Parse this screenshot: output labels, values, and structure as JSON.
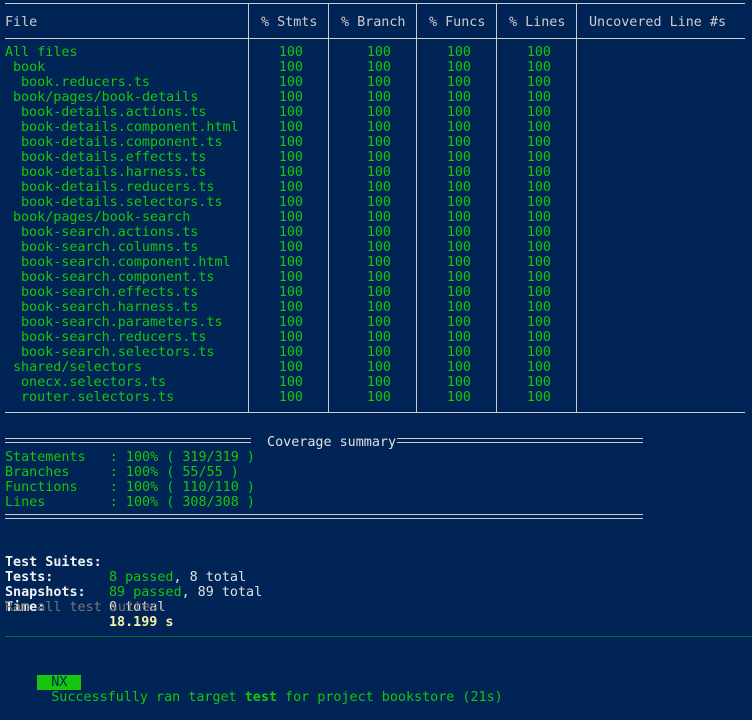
{
  "header": {
    "file": "File",
    "stmts": "% Stmts",
    "branch": "% Branch",
    "funcs": "% Funcs",
    "lines": "% Lines",
    "uncovered": "Uncovered Line #s"
  },
  "rows": [
    {
      "name": "All files",
      "indent": 0,
      "stmts": "100",
      "branch": "100",
      "funcs": "100",
      "lines": "100",
      "uncovered": ""
    },
    {
      "name": "book",
      "indent": 1,
      "stmts": "100",
      "branch": "100",
      "funcs": "100",
      "lines": "100",
      "uncovered": ""
    },
    {
      "name": "book.reducers.ts",
      "indent": 2,
      "stmts": "100",
      "branch": "100",
      "funcs": "100",
      "lines": "100",
      "uncovered": ""
    },
    {
      "name": "book/pages/book-details",
      "indent": 1,
      "stmts": "100",
      "branch": "100",
      "funcs": "100",
      "lines": "100",
      "uncovered": ""
    },
    {
      "name": "book-details.actions.ts",
      "indent": 2,
      "stmts": "100",
      "branch": "100",
      "funcs": "100",
      "lines": "100",
      "uncovered": ""
    },
    {
      "name": "book-details.component.html",
      "indent": 2,
      "stmts": "100",
      "branch": "100",
      "funcs": "100",
      "lines": "100",
      "uncovered": ""
    },
    {
      "name": "book-details.component.ts",
      "indent": 2,
      "stmts": "100",
      "branch": "100",
      "funcs": "100",
      "lines": "100",
      "uncovered": ""
    },
    {
      "name": "book-details.effects.ts",
      "indent": 2,
      "stmts": "100",
      "branch": "100",
      "funcs": "100",
      "lines": "100",
      "uncovered": ""
    },
    {
      "name": "book-details.harness.ts",
      "indent": 2,
      "stmts": "100",
      "branch": "100",
      "funcs": "100",
      "lines": "100",
      "uncovered": ""
    },
    {
      "name": "book-details.reducers.ts",
      "indent": 2,
      "stmts": "100",
      "branch": "100",
      "funcs": "100",
      "lines": "100",
      "uncovered": ""
    },
    {
      "name": "book-details.selectors.ts",
      "indent": 2,
      "stmts": "100",
      "branch": "100",
      "funcs": "100",
      "lines": "100",
      "uncovered": ""
    },
    {
      "name": "book/pages/book-search",
      "indent": 1,
      "stmts": "100",
      "branch": "100",
      "funcs": "100",
      "lines": "100",
      "uncovered": ""
    },
    {
      "name": "book-search.actions.ts",
      "indent": 2,
      "stmts": "100",
      "branch": "100",
      "funcs": "100",
      "lines": "100",
      "uncovered": ""
    },
    {
      "name": "book-search.columns.ts",
      "indent": 2,
      "stmts": "100",
      "branch": "100",
      "funcs": "100",
      "lines": "100",
      "uncovered": ""
    },
    {
      "name": "book-search.component.html",
      "indent": 2,
      "stmts": "100",
      "branch": "100",
      "funcs": "100",
      "lines": "100",
      "uncovered": ""
    },
    {
      "name": "book-search.component.ts",
      "indent": 2,
      "stmts": "100",
      "branch": "100",
      "funcs": "100",
      "lines": "100",
      "uncovered": ""
    },
    {
      "name": "book-search.effects.ts",
      "indent": 2,
      "stmts": "100",
      "branch": "100",
      "funcs": "100",
      "lines": "100",
      "uncovered": ""
    },
    {
      "name": "book-search.harness.ts",
      "indent": 2,
      "stmts": "100",
      "branch": "100",
      "funcs": "100",
      "lines": "100",
      "uncovered": ""
    },
    {
      "name": "book-search.parameters.ts",
      "indent": 2,
      "stmts": "100",
      "branch": "100",
      "funcs": "100",
      "lines": "100",
      "uncovered": ""
    },
    {
      "name": "book-search.reducers.ts",
      "indent": 2,
      "stmts": "100",
      "branch": "100",
      "funcs": "100",
      "lines": "100",
      "uncovered": ""
    },
    {
      "name": "book-search.selectors.ts",
      "indent": 2,
      "stmts": "100",
      "branch": "100",
      "funcs": "100",
      "lines": "100",
      "uncovered": ""
    },
    {
      "name": "shared/selectors",
      "indent": 1,
      "stmts": "100",
      "branch": "100",
      "funcs": "100",
      "lines": "100",
      "uncovered": ""
    },
    {
      "name": "onecx.selectors.ts",
      "indent": 2,
      "stmts": "100",
      "branch": "100",
      "funcs": "100",
      "lines": "100",
      "uncovered": ""
    },
    {
      "name": "router.selectors.ts",
      "indent": 2,
      "stmts": "100",
      "branch": "100",
      "funcs": "100",
      "lines": "100",
      "uncovered": ""
    }
  ],
  "summary": {
    "title": " Coverage summary ",
    "items": [
      {
        "label": "Statements   : 100% ( 319/319 )"
      },
      {
        "label": "Branches     : 100% ( 55/55 )"
      },
      {
        "label": "Functions    : 100% ( 110/110 )"
      },
      {
        "label": "Lines        : 100% ( 308/308 )"
      }
    ]
  },
  "results": {
    "suites_label": "Test Suites:",
    "suites_passed": "8 passed",
    "suites_total": ", 8 total",
    "tests_label": "Tests:",
    "tests_passed": "89 passed",
    "tests_total": ", 89 total",
    "snapshots_label": "Snapshots:",
    "snapshots_value": "0 total",
    "time_label": "Time:",
    "time_value": "18.199 s",
    "ran_all": "Ran all test suites."
  },
  "nx": {
    "badge": "NX",
    "msg_prefix": "Successfully ran target ",
    "target": "test",
    "msg_suffix": " for project bookstore (21s)"
  },
  "colors": {
    "background": "#012456",
    "pass": "#16c60c",
    "text": "#cccccc"
  }
}
